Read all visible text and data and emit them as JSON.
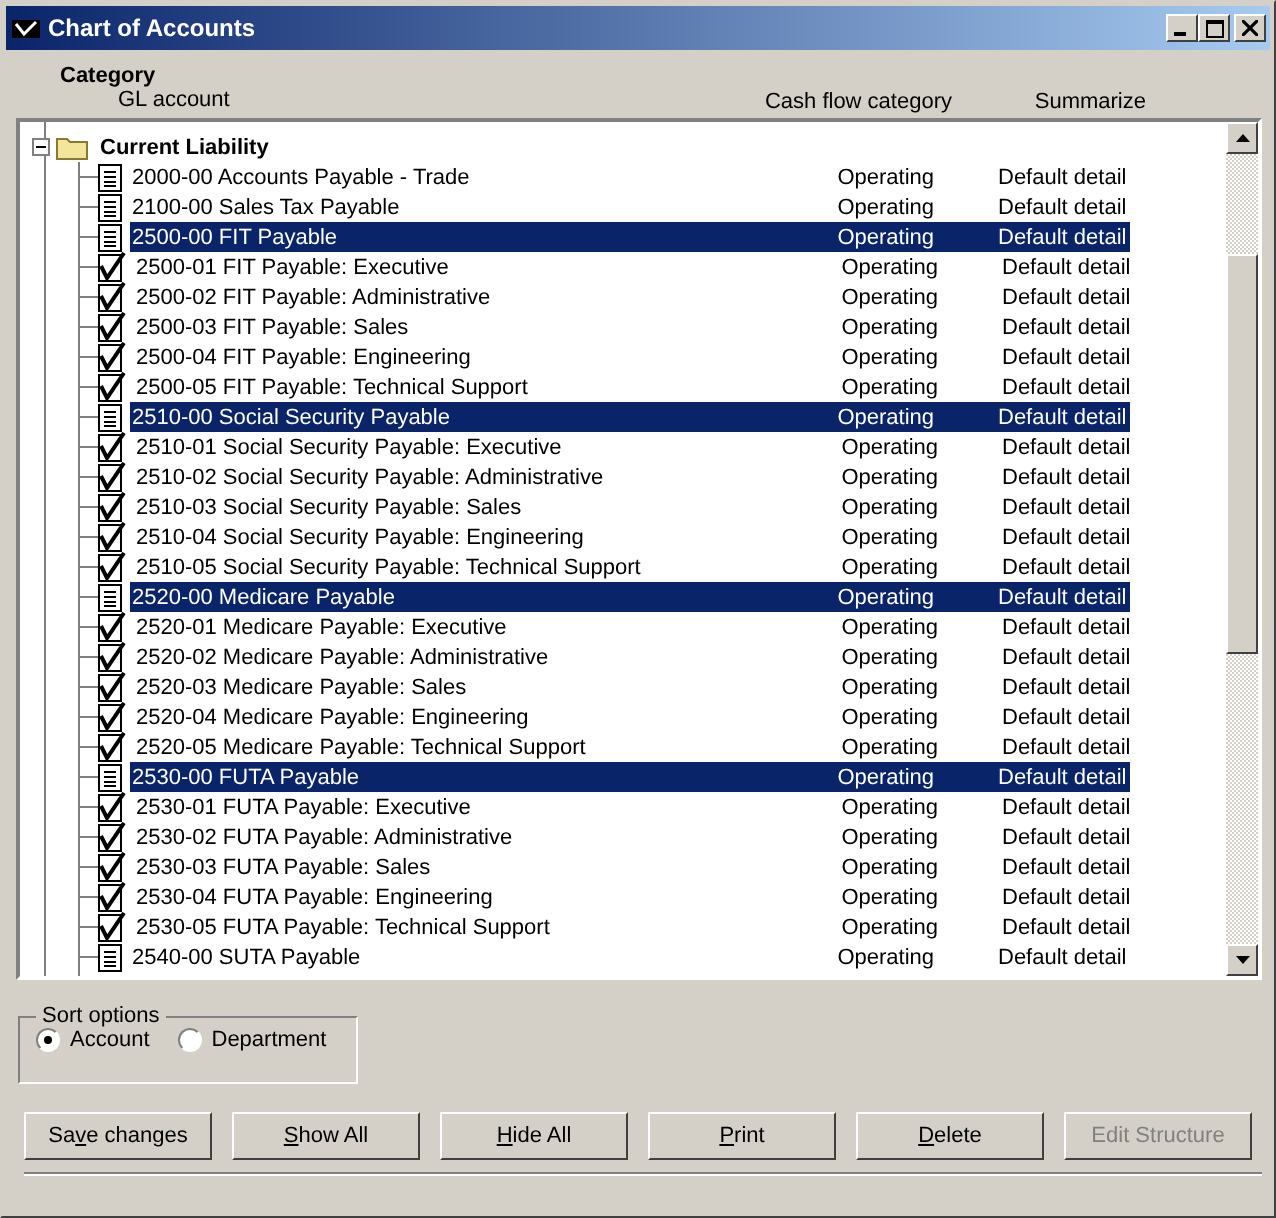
{
  "window": {
    "title": "Chart of Accounts"
  },
  "columns": {
    "category": "Category",
    "account": "GL account",
    "cash_flow": "Cash flow category",
    "summarize": "Summarize"
  },
  "category": {
    "name": "Current Liability",
    "expanded": true
  },
  "rows": [
    {
      "kind": "plain",
      "name": "2000-00 Accounts Payable - Trade",
      "cash_flow": "Operating",
      "summarize": "Default detail",
      "selected": false
    },
    {
      "kind": "plain",
      "name": "2100-00 Sales Tax Payable",
      "cash_flow": "Operating",
      "summarize": "Default detail",
      "selected": false
    },
    {
      "kind": "plain",
      "name": "2500-00 FIT Payable",
      "cash_flow": "Operating",
      "summarize": "Default detail",
      "selected": true
    },
    {
      "kind": "checked",
      "name": "2500-01 FIT Payable: Executive",
      "cash_flow": "Operating",
      "summarize": "Default detail",
      "selected": false
    },
    {
      "kind": "checked",
      "name": "2500-02 FIT Payable: Administrative",
      "cash_flow": "Operating",
      "summarize": "Default detail",
      "selected": false
    },
    {
      "kind": "checked",
      "name": "2500-03 FIT Payable: Sales",
      "cash_flow": "Operating",
      "summarize": "Default detail",
      "selected": false
    },
    {
      "kind": "checked",
      "name": "2500-04 FIT Payable: Engineering",
      "cash_flow": "Operating",
      "summarize": "Default detail",
      "selected": false
    },
    {
      "kind": "checked",
      "name": "2500-05 FIT Payable: Technical Support",
      "cash_flow": "Operating",
      "summarize": "Default detail",
      "selected": false
    },
    {
      "kind": "plain",
      "name": "2510-00 Social Security Payable",
      "cash_flow": "Operating",
      "summarize": "Default detail",
      "selected": true
    },
    {
      "kind": "checked",
      "name": "2510-01 Social Security Payable: Executive",
      "cash_flow": "Operating",
      "summarize": "Default detail",
      "selected": false
    },
    {
      "kind": "checked",
      "name": "2510-02 Social Security Payable: Administrative",
      "cash_flow": "Operating",
      "summarize": "Default detail",
      "selected": false
    },
    {
      "kind": "checked",
      "name": "2510-03 Social Security Payable: Sales",
      "cash_flow": "Operating",
      "summarize": "Default detail",
      "selected": false
    },
    {
      "kind": "checked",
      "name": "2510-04 Social Security Payable: Engineering",
      "cash_flow": "Operating",
      "summarize": "Default detail",
      "selected": false
    },
    {
      "kind": "checked",
      "name": "2510-05 Social Security Payable: Technical Support",
      "cash_flow": "Operating",
      "summarize": "Default detail",
      "selected": false
    },
    {
      "kind": "plain",
      "name": "2520-00 Medicare Payable",
      "cash_flow": "Operating",
      "summarize": "Default detail",
      "selected": true
    },
    {
      "kind": "checked",
      "name": "2520-01 Medicare Payable: Executive",
      "cash_flow": "Operating",
      "summarize": "Default detail",
      "selected": false
    },
    {
      "kind": "checked",
      "name": "2520-02 Medicare Payable: Administrative",
      "cash_flow": "Operating",
      "summarize": "Default detail",
      "selected": false
    },
    {
      "kind": "checked",
      "name": "2520-03 Medicare Payable: Sales",
      "cash_flow": "Operating",
      "summarize": "Default detail",
      "selected": false
    },
    {
      "kind": "checked",
      "name": "2520-04 Medicare Payable: Engineering",
      "cash_flow": "Operating",
      "summarize": "Default detail",
      "selected": false
    },
    {
      "kind": "checked",
      "name": "2520-05 Medicare Payable: Technical Support",
      "cash_flow": "Operating",
      "summarize": "Default detail",
      "selected": false
    },
    {
      "kind": "plain",
      "name": "2530-00 FUTA Payable",
      "cash_flow": "Operating",
      "summarize": "Default detail",
      "selected": true
    },
    {
      "kind": "checked",
      "name": "2530-01 FUTA Payable: Executive",
      "cash_flow": "Operating",
      "summarize": "Default detail",
      "selected": false
    },
    {
      "kind": "checked",
      "name": "2530-02 FUTA Payable: Administrative",
      "cash_flow": "Operating",
      "summarize": "Default detail",
      "selected": false
    },
    {
      "kind": "checked",
      "name": "2530-03 FUTA Payable: Sales",
      "cash_flow": "Operating",
      "summarize": "Default detail",
      "selected": false
    },
    {
      "kind": "checked",
      "name": "2530-04 FUTA Payable: Engineering",
      "cash_flow": "Operating",
      "summarize": "Default detail",
      "selected": false
    },
    {
      "kind": "checked",
      "name": "2530-05 FUTA Payable: Technical Support",
      "cash_flow": "Operating",
      "summarize": "Default detail",
      "selected": false
    },
    {
      "kind": "plain",
      "name": "2540-00 SUTA Payable",
      "cash_flow": "Operating",
      "summarize": "Default detail",
      "selected": false
    }
  ],
  "sort_options": {
    "title": "Sort options",
    "options": [
      {
        "label": "Account",
        "selected": true
      },
      {
        "label": "Department",
        "selected": false
      }
    ]
  },
  "buttons": [
    {
      "before": "Sa",
      "key": "v",
      "after": "e changes",
      "disabled": false
    },
    {
      "key": "S",
      "after": "how All",
      "disabled": false
    },
    {
      "key": "H",
      "after": "ide All",
      "disabled": false
    },
    {
      "key": "P",
      "after": "rint",
      "disabled": false
    },
    {
      "key": "D",
      "after": "elete",
      "disabled": false
    },
    {
      "before": "Edit Structure",
      "disabled": true
    }
  ]
}
